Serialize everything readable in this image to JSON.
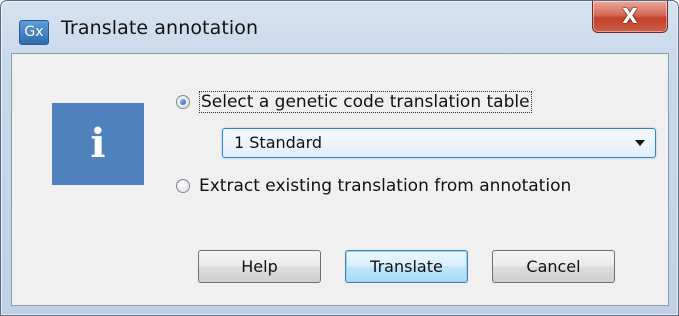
{
  "window": {
    "title": "Translate annotation",
    "app_icon_text": "Gx",
    "close_glyph": "X",
    "icon": "info-icon",
    "icon_glyph": "i",
    "icon_color": "#4f81bd"
  },
  "options": {
    "radio1_label": "Select a genetic code translation table",
    "radio1_checked": true,
    "dropdown_value": "1 Standard",
    "radio2_label": "Extract existing translation from annotation",
    "radio2_checked": false
  },
  "buttons": {
    "help": "Help",
    "translate": "Translate",
    "cancel": "Cancel"
  }
}
